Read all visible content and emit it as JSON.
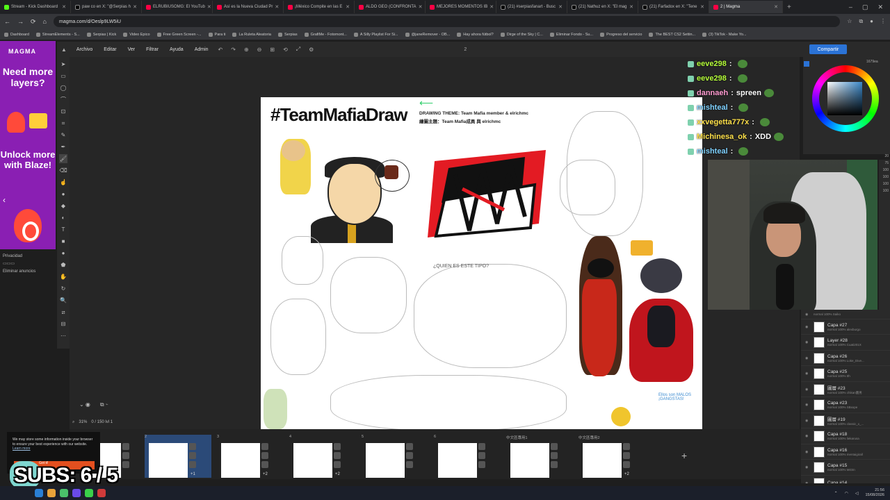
{
  "browser": {
    "tabs": [
      {
        "label": "Stream - Kick Dashboard",
        "fav": "k"
      },
      {
        "label": "paw co en X: \"@Serpias h",
        "fav": "x"
      },
      {
        "label": "ELRUBIUSOMG: El YouTub",
        "fav": "m"
      },
      {
        "label": "Así es la Nueva Ciudad Pr",
        "fav": "m"
      },
      {
        "label": "¡México Compite en las E",
        "fav": "m"
      },
      {
        "label": "ALDO GEO (CONFRONTA",
        "fav": "m"
      },
      {
        "label": "MEJORES MOMENTOS IB",
        "fav": "m"
      },
      {
        "label": "(21) #serpiasfanart - Busc",
        "fav": "x"
      },
      {
        "label": "(21) Nathuz en X: \"El mag",
        "fav": "x"
      },
      {
        "label": "(21) Farfadox en X: \"Tene",
        "fav": "x"
      },
      {
        "label": "2 | Magma",
        "fav": "m",
        "active": true
      }
    ],
    "new_tab": "+",
    "url": "magma.com/d/Oeslp9LW5iU",
    "bookmarks": [
      "Dashboard",
      "StreamElements - S...",
      "Serpias | Kick",
      "Video Epico",
      "Free Green Screen -...",
      "Para ti",
      "La Ruleta Aleatoria",
      "Serpias",
      "GrafiMe - Fotomont...",
      "A Silly Playlist For Si...",
      "@janeRemover - OB...",
      "Hay ahora fútbol?",
      "Dirge of the Sky | C...",
      "Eliminar Fondo - Su...",
      "Progreso del servicio",
      "The BEST CS2 Settin...",
      "(3) TikTok - Make Yo..."
    ]
  },
  "ad": {
    "brand": "MAGMA",
    "headline": "Need more layers?",
    "cta": "Unlock more with Blaze!",
    "privacy": "Privacidad",
    "remove": "Eliminar anuncios"
  },
  "app": {
    "menus": [
      "Archivo",
      "Editar",
      "Ver",
      "Filtrar",
      "Ayuda",
      "Admin"
    ],
    "page_indicator": "2",
    "share": "Compartir",
    "zoom": "31%",
    "page_count": "0 / 150  lvl 1"
  },
  "canvas": {
    "title": "#TeamMafiaDraw",
    "theme_en": "DRAWING THEME: Team Mafia member & elrichmc",
    "theme_zh": "繪圖主題：Team Mafia成員 與 elrichmc",
    "note1": "¿QUIEN ES ESTE TIPO?",
    "note2": "Ellos son MALOS ¡GANGSTAS!"
  },
  "chat": [
    {
      "user": "eeve298",
      "msg": "",
      "color": "#b6ff3a"
    },
    {
      "user": "eeve298",
      "msg": "",
      "color": "#b6ff3a"
    },
    {
      "user": "dannaeh",
      "msg": "spreen",
      "color": "#ff9bd1"
    },
    {
      "user": "mishteal",
      "msg": "",
      "color": "#7fd1ff"
    },
    {
      "user": "xxvegetta777x",
      "msg": "",
      "color": "#ffe14a"
    },
    {
      "user": "Michinesa_ok",
      "msg": "XDD",
      "color": "#ffe14a"
    },
    {
      "user": "mishteal",
      "msg": "",
      "color": "#7fd1ff"
    }
  ],
  "picker": {
    "hex": "1679ea",
    "size_label": "Tamaño x1"
  },
  "layers": [
    {
      "name": "Capa #27",
      "mode": "normal 100%  alexburgo"
    },
    {
      "name": "Layer #28",
      "mode": "normal 100%  Cuati201X"
    },
    {
      "name": "Capa #26",
      "mode": "normal 100%  Loke_Dive..."
    },
    {
      "name": "Capa #25",
      "mode": "normal 100%  tth"
    },
    {
      "name": "圖層 #23",
      "mode": "normal 100%  chikan圖男"
    },
    {
      "name": "Capa #23",
      "mode": "normal 100%  SBxxpe"
    },
    {
      "name": "圖層 #19",
      "mode": "normal 100%  classic_x_..."
    },
    {
      "name": "Capa #18",
      "mode": "normal 100%  liekarusa"
    },
    {
      "name": "Capa #16",
      "mode": "normal 100%  mentaigirall"
    },
    {
      "name": "Capa #15",
      "mode": "normal 100%  MiGtn"
    },
    {
      "name": "Capa #14",
      "mode": ""
    }
  ],
  "layers_top": {
    "name": "",
    "mode": "normal 100%  Saiko"
  },
  "side_numbers": [
    "20",
    "75",
    "100",
    "100",
    "100",
    "100"
  ],
  "pages": [
    {
      "num": "",
      "badge": ""
    },
    {
      "num": "2",
      "badge": "+1",
      "selected": true
    },
    {
      "num": "3",
      "badge": "+2"
    },
    {
      "num": "4",
      "badge": "+2"
    },
    {
      "num": "5",
      "badge": ""
    },
    {
      "num": "6",
      "badge": ""
    },
    {
      "num": "中文區專用1",
      "badge": ""
    },
    {
      "num": "中文區專用2",
      "badge": "+2"
    }
  ],
  "add_page": "+",
  "cookie": {
    "text": "We may store some information inside your browser to ensure your best experience with our website.",
    "link": "Learn more",
    "button": "Got it!"
  },
  "subs": "SUBS: 6 / 5",
  "taskbar": {
    "time": "21:56",
    "date": "15/08/2026"
  }
}
